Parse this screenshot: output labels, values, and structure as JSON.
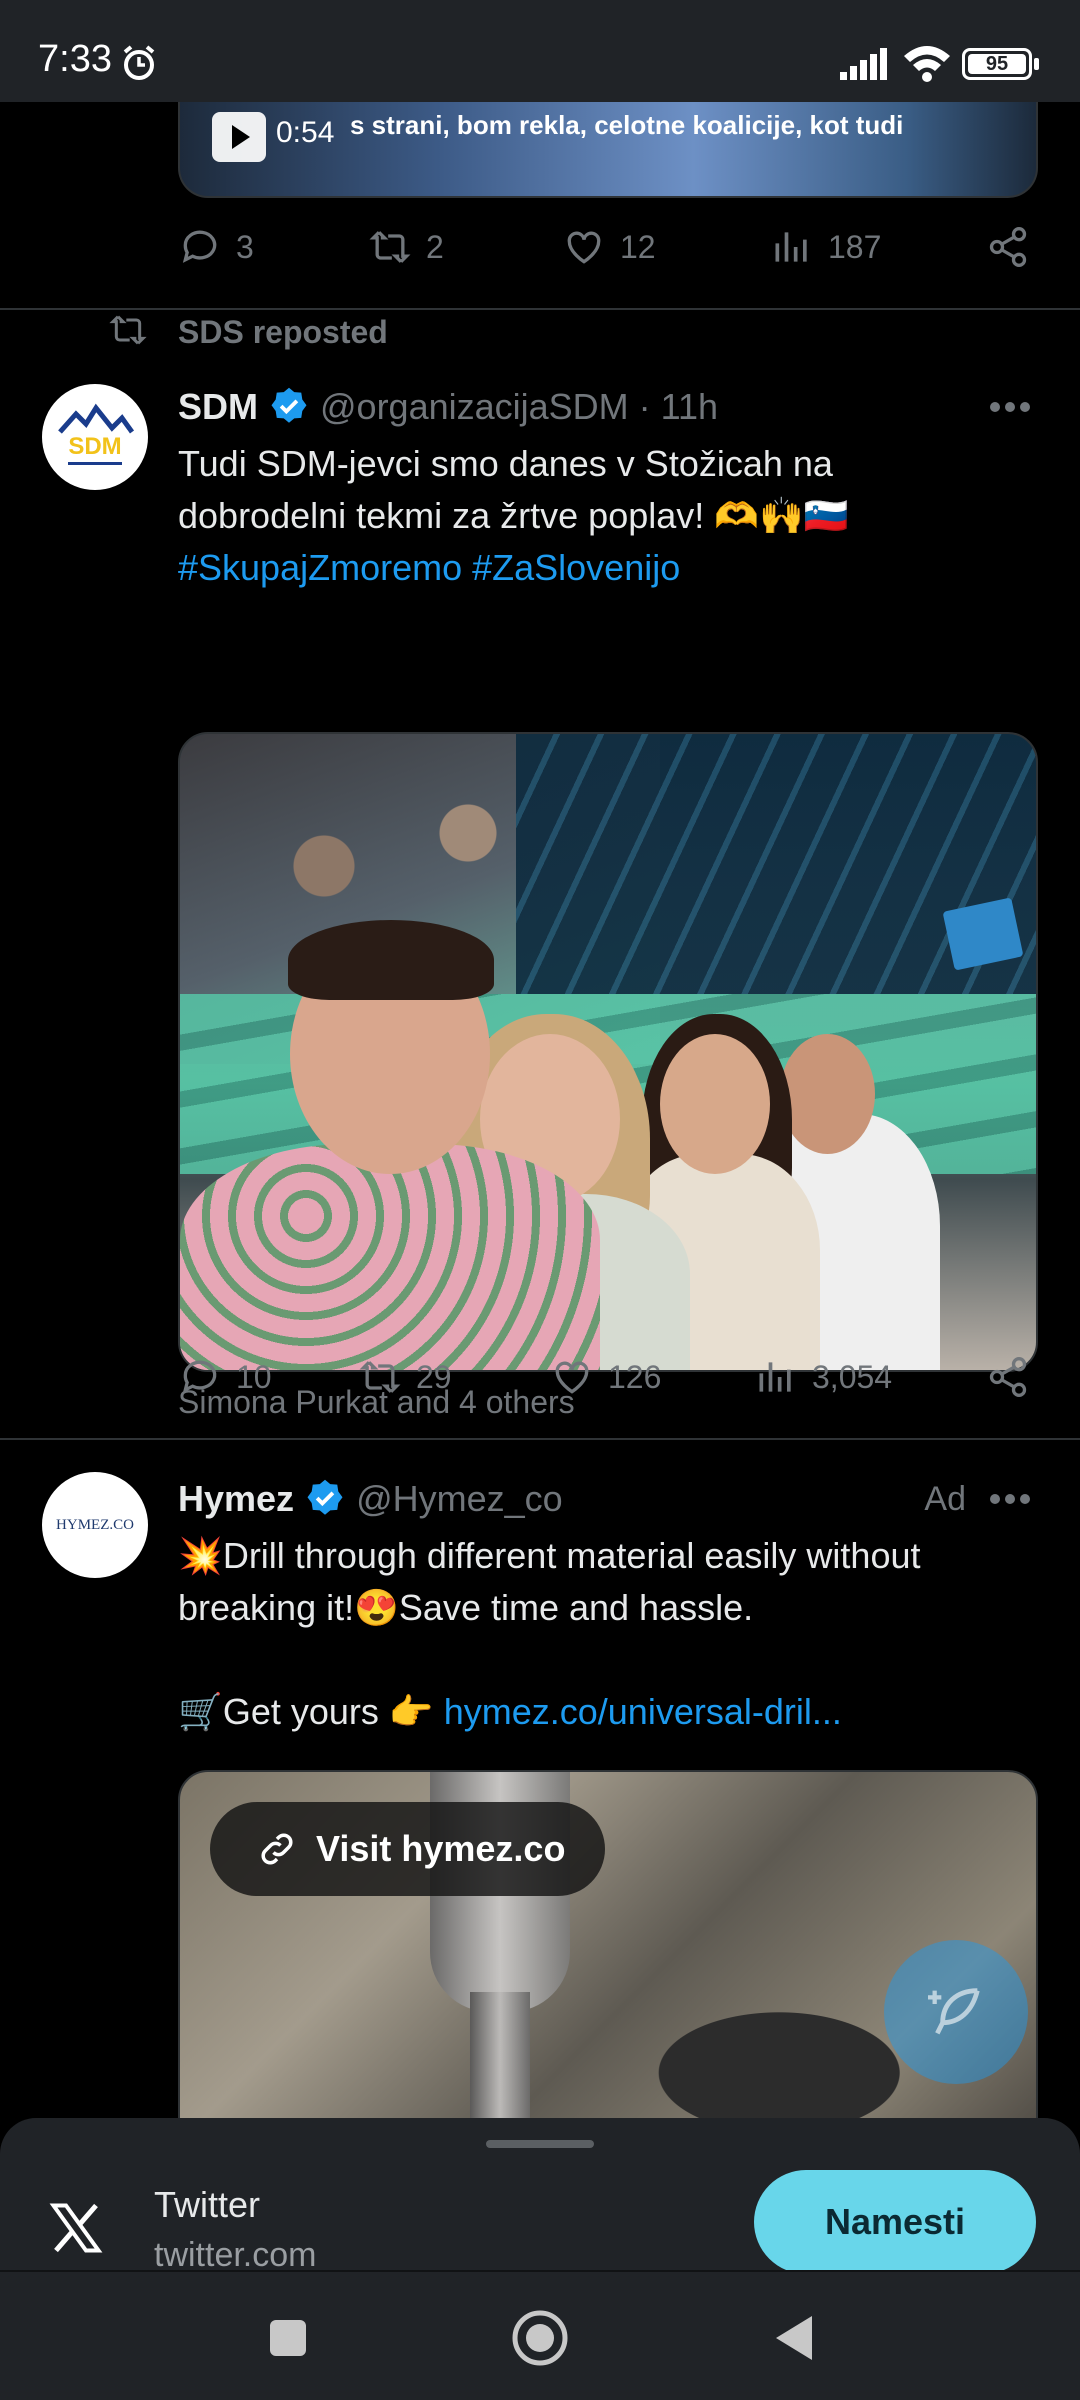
{
  "status_bar": {
    "time": "7:33",
    "battery": "95"
  },
  "prev_tweet": {
    "video": {
      "duration": "0:54",
      "caption": "s strani, bom rekla, celotne koalicije, kot tudi"
    },
    "actions": {
      "replies": "3",
      "reposts": "2",
      "likes": "12",
      "views": "187"
    }
  },
  "tweet": {
    "repost_label": "SDS reposted",
    "name": "SDM",
    "handle": "@organizacijaSDM · 11h",
    "text_line1": "Tudi SDM-jevci smo danes v Stožicah na",
    "text_line2": "dobrodelni tekmi za žrtve poplav! 🫶🙌🇸🇮",
    "hashtags": "#SkupajZmoremo #ZaSlovenijo",
    "liked_by": "Simona Purkat and 4 others",
    "actions": {
      "replies": "10",
      "reposts": "29",
      "likes": "126",
      "views": "3,054"
    }
  },
  "ad": {
    "name": "Hymez",
    "handle": "@Hymez_co",
    "ad_label": "Ad",
    "avatar_text": "HYMEZ.CO",
    "text_line1": "💥Drill through different material easily without",
    "text_line2": "breaking it!😍Save time and hassle.",
    "cta_prefix": "🛒Get yours 👉 ",
    "link": "hymez.co/universal-dril...",
    "visit_label": "Visit hymez.co"
  },
  "install_banner": {
    "app_name": "Twitter",
    "app_url": "twitter.com",
    "button": "Namesti"
  },
  "colors": {
    "accent": "#1d9bf0",
    "install_button": "#68d6ea",
    "background": "#000000"
  }
}
